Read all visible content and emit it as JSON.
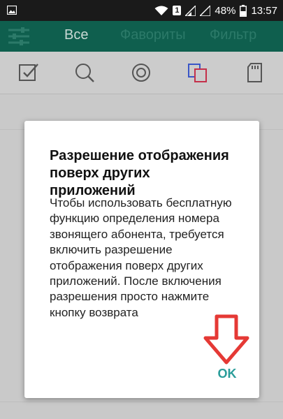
{
  "status_bar": {
    "sim_label": "1",
    "battery": "48%",
    "time": "13:57"
  },
  "app_bar": {
    "tabs": [
      {
        "label": "Все"
      },
      {
        "label": "Фавориты"
      },
      {
        "label": "Фильтр"
      }
    ]
  },
  "toolbar": {
    "icons": [
      "checkbox-icon",
      "search-icon",
      "target-icon",
      "copy-icon",
      "sd-card-icon"
    ]
  },
  "dialog": {
    "title": "Разрешение отображения поверх других приложений",
    "message": "Чтобы использовать бесплатную функцию определения номера звонящего абонента, требуется включить разрешение отображения поверх других приложений. После включения разрешения просто нажмите кнопку возврата",
    "ok_label": "OK"
  },
  "colors": {
    "app_bar": "#0f5f4e",
    "accent": "#2a9d9a",
    "arrow": "#e53935"
  }
}
